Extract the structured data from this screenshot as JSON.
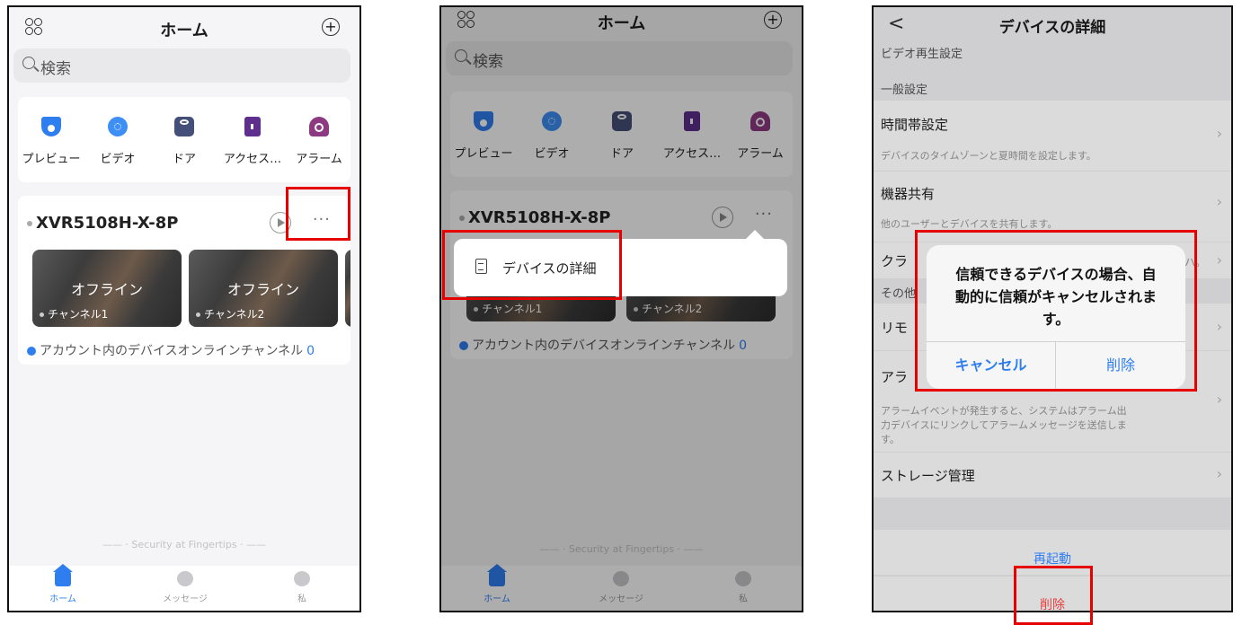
{
  "home": {
    "title": "ホーム",
    "search_placeholder": "検索",
    "quick_actions": [
      {
        "label": "プレビュー",
        "icon": "camera-icon",
        "color": "#2f7ef0"
      },
      {
        "label": "ビデオ",
        "icon": "video-icon",
        "color": "#3d8ff5"
      },
      {
        "label": "ドア",
        "icon": "door-icon",
        "color": "#45507a"
      },
      {
        "label": "アクセス…",
        "icon": "access-icon",
        "color": "#5e2f8c"
      },
      {
        "label": "アラーム",
        "icon": "alarm-icon",
        "color": "#8e3a82"
      }
    ],
    "device": {
      "name": "XVR5108H-X-8P",
      "more": "···",
      "channels": [
        {
          "status": "オフライン",
          "name": "チャンネル1"
        },
        {
          "status": "オフライン",
          "name": "チャンネル2"
        }
      ],
      "footer_text": "アカウント内のデバイスオンラインチャンネル",
      "footer_count": "0"
    },
    "tagline": "—— · Security at Fingertips · ——",
    "tabs": [
      {
        "label": "ホーム",
        "icon": "home-icon"
      },
      {
        "label": "メッセージ",
        "icon": "message-icon"
      },
      {
        "label": "私",
        "icon": "profile-icon"
      }
    ]
  },
  "menu": {
    "item": "デバイスの詳細"
  },
  "details": {
    "title": "デバイスの詳細",
    "back": "<",
    "sections": {
      "video": "ビデオ再生設定",
      "general": "一般設定",
      "other_partial": "その他"
    },
    "rows": {
      "time_title": "時間帯設定",
      "time_sub": "デバイスのタイムゾーンと夏時間を設定します。",
      "share_title": "機器共有",
      "share_sub": "他のユーザーとデバイスを共有します。",
      "cloud_partial": "クラ",
      "cloud_right_partial": "ハ。",
      "remote_partial": "リモ",
      "alarm_partial": "アラ",
      "alarm_sub_1": "アラームイベントが発生すると、システムはアラーム出",
      "alarm_sub_2": "力デバイスにリンクしてアラームメッセージを送信しま",
      "alarm_sub_3": "す。",
      "storage_title": "ストレージ管理",
      "chevron": "›"
    },
    "restart": "再起動",
    "delete": "削除",
    "dialog": {
      "message_1": "信頼できるデバイスの場合、自",
      "message_2": "動的に信頼がキャンセルされま",
      "message_3": "す。",
      "cancel": "キャンセル",
      "confirm": "削除"
    }
  },
  "colors": {
    "accent": "#2f7ef0",
    "highlight": "#e60000",
    "danger": "#e64040"
  }
}
